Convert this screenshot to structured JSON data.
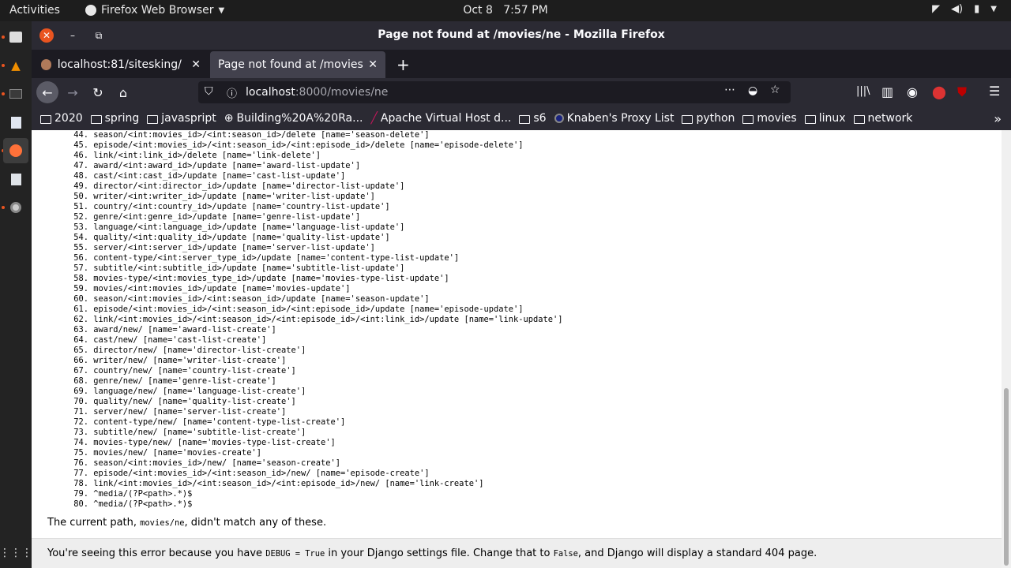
{
  "topbar": {
    "activities": "Activities",
    "app_name": "Firefox Web Browser",
    "date": "Oct 8",
    "time": "7:57 PM"
  },
  "window": {
    "title": "Page not found at /movies/ne - Mozilla Firefox"
  },
  "tabs": [
    {
      "title": "localhost:81/sitesking/"
    },
    {
      "title": "Page not found at /movies/n"
    }
  ],
  "urlbar": {
    "host": "localhost",
    "path": ":8000/movies/ne"
  },
  "bookmarks": [
    {
      "label": "2020",
      "icon": "folder-icon"
    },
    {
      "label": "spring",
      "icon": "folder-icon"
    },
    {
      "label": "javaspript",
      "icon": "folder-icon"
    },
    {
      "label": "Building%20A%20Ra...",
      "icon": "globe-icon"
    },
    {
      "label": "Apache Virtual Host d...",
      "icon": "feather-icon"
    },
    {
      "label": "s6",
      "icon": "folder-icon"
    },
    {
      "label": "Knaben's Proxy List",
      "icon": "site-icon"
    },
    {
      "label": "python",
      "icon": "folder-icon"
    },
    {
      "label": "movies",
      "icon": "folder-icon"
    },
    {
      "label": "linux",
      "icon": "folder-icon"
    },
    {
      "label": "network",
      "icon": "folder-icon"
    }
  ],
  "routes": [
    {
      "n": "44.",
      "p": "season/<int:movies_id>/<int:season_id>/delete [name='season-delete']"
    },
    {
      "n": "45.",
      "p": "episode/<int:movies_id>/<int:season_id>/<int:episode_id>/delete [name='episode-delete']"
    },
    {
      "n": "46.",
      "p": "link/<int:link_id>/delete [name='link-delete']"
    },
    {
      "n": "47.",
      "p": "award/<int:award_id>/update [name='award-list-update']"
    },
    {
      "n": "48.",
      "p": "cast/<int:cast_id>/update [name='cast-list-update']"
    },
    {
      "n": "49.",
      "p": "director/<int:director_id>/update [name='director-list-update']"
    },
    {
      "n": "50.",
      "p": "writer/<int:writer_id>/update [name='writer-list-update']"
    },
    {
      "n": "51.",
      "p": "country/<int:country_id>/update [name='country-list-update']"
    },
    {
      "n": "52.",
      "p": "genre/<int:genre_id>/update [name='genre-list-update']"
    },
    {
      "n": "53.",
      "p": "language/<int:language_id>/update [name='language-list-update']"
    },
    {
      "n": "54.",
      "p": "quality/<int:quality_id>/update [name='quality-list-update']"
    },
    {
      "n": "55.",
      "p": "server/<int:server_id>/update [name='server-list-update']"
    },
    {
      "n": "56.",
      "p": "content-type/<int:server_type_id>/update [name='content-type-list-update']"
    },
    {
      "n": "57.",
      "p": "subtitle/<int:subtitle_id>/update [name='subtitle-list-update']"
    },
    {
      "n": "58.",
      "p": "movies-type/<int:movies_type_id>/update [name='movies-type-list-update']"
    },
    {
      "n": "59.",
      "p": "movies/<int:movies_id>/update [name='movies-update']"
    },
    {
      "n": "60.",
      "p": "season/<int:movies_id>/<int:season_id>/update [name='season-update']"
    },
    {
      "n": "61.",
      "p": "episode/<int:movies_id>/<int:season_id>/<int:episode_id>/update [name='episode-update']"
    },
    {
      "n": "62.",
      "p": "link/<int:movies_id>/<int:season_id>/<int:episode_id>/<int:link_id>/update [name='link-update']"
    },
    {
      "n": "63.",
      "p": "award/new/ [name='award-list-create']"
    },
    {
      "n": "64.",
      "p": "cast/new/ [name='cast-list-create']"
    },
    {
      "n": "65.",
      "p": "director/new/ [name='director-list-create']"
    },
    {
      "n": "66.",
      "p": "writer/new/ [name='writer-list-create']"
    },
    {
      "n": "67.",
      "p": "country/new/ [name='country-list-create']"
    },
    {
      "n": "68.",
      "p": "genre/new/ [name='genre-list-create']"
    },
    {
      "n": "69.",
      "p": "language/new/ [name='language-list-create']"
    },
    {
      "n": "70.",
      "p": "quality/new/ [name='quality-list-create']"
    },
    {
      "n": "71.",
      "p": "server/new/ [name='server-list-create']"
    },
    {
      "n": "72.",
      "p": "content-type/new/ [name='content-type-list-create']"
    },
    {
      "n": "73.",
      "p": "subtitle/new/ [name='subtitle-list-create']"
    },
    {
      "n": "74.",
      "p": "movies-type/new/ [name='movies-type-list-create']"
    },
    {
      "n": "75.",
      "p": "movies/new/ [name='movies-create']"
    },
    {
      "n": "76.",
      "p": "season/<int:movies_id>/new/ [name='season-create']"
    },
    {
      "n": "77.",
      "p": "episode/<int:movies_id>/<int:season_id>/new/ [name='episode-create']"
    },
    {
      "n": "78.",
      "p": "link/<int:movies_id>/<int:season_id>/<int:episode_id>/new/ [name='link-create']"
    },
    {
      "n": "79.",
      "p": "^media/(?P<path>.*)$"
    },
    {
      "n": "80.",
      "p": "^media/(?P<path>.*)$"
    }
  ],
  "current_path": {
    "before": "The current path, ",
    "path": "movies/ne",
    "after": ", didn't match any of these."
  },
  "explanation": {
    "part1": "You're seeing this error because you have ",
    "code1": "DEBUG = True",
    "part2": " in your Django settings file. Change that to ",
    "code2": "False",
    "part3": ", and Django will display a standard 404 page."
  },
  "colors": {
    "close_button": "#e95420",
    "ubuntu_accent": "#e95420",
    "firefox_chrome": "#2b2a33"
  }
}
